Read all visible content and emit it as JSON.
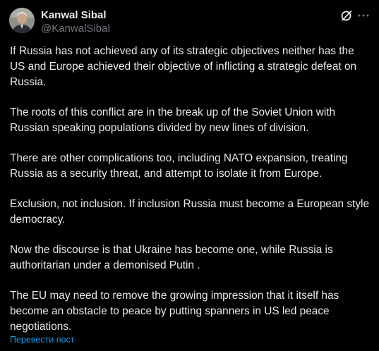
{
  "author": {
    "display_name": "Kanwal Sibal",
    "handle": "@KanwalSibal"
  },
  "icons": {
    "grok": "grok-icon",
    "more": "more-options-icon"
  },
  "post": {
    "paragraphs": [
      "If Russia has not achieved any of its strategic objectives neither has the US and Europe achieved their objective of inflicting a strategic defeat on Russia.",
      "The roots of this conflict are in the break up of the Soviet Union with Russian speaking populations divided by new lines of division.",
      "There are other complications too, including NATO expansion, treating Russia as a security threat,  and attempt to isolate it from Europe.",
      "Exclusion, not inclusion. If inclusion Russia must become a European style democracy.",
      "Now the discourse is that Ukraine has become one, while Russia is authoritarian under a demonised Putin .",
      "The EU may need to remove the growing impression that it itself has become an obstacle to peace by putting spanners in US led peace negotiations."
    ],
    "translate_label": "Перевести пост"
  },
  "colors": {
    "background": "#000000",
    "text": "#e7e9ea",
    "secondary": "#71767b",
    "link": "#1d9bf0"
  }
}
